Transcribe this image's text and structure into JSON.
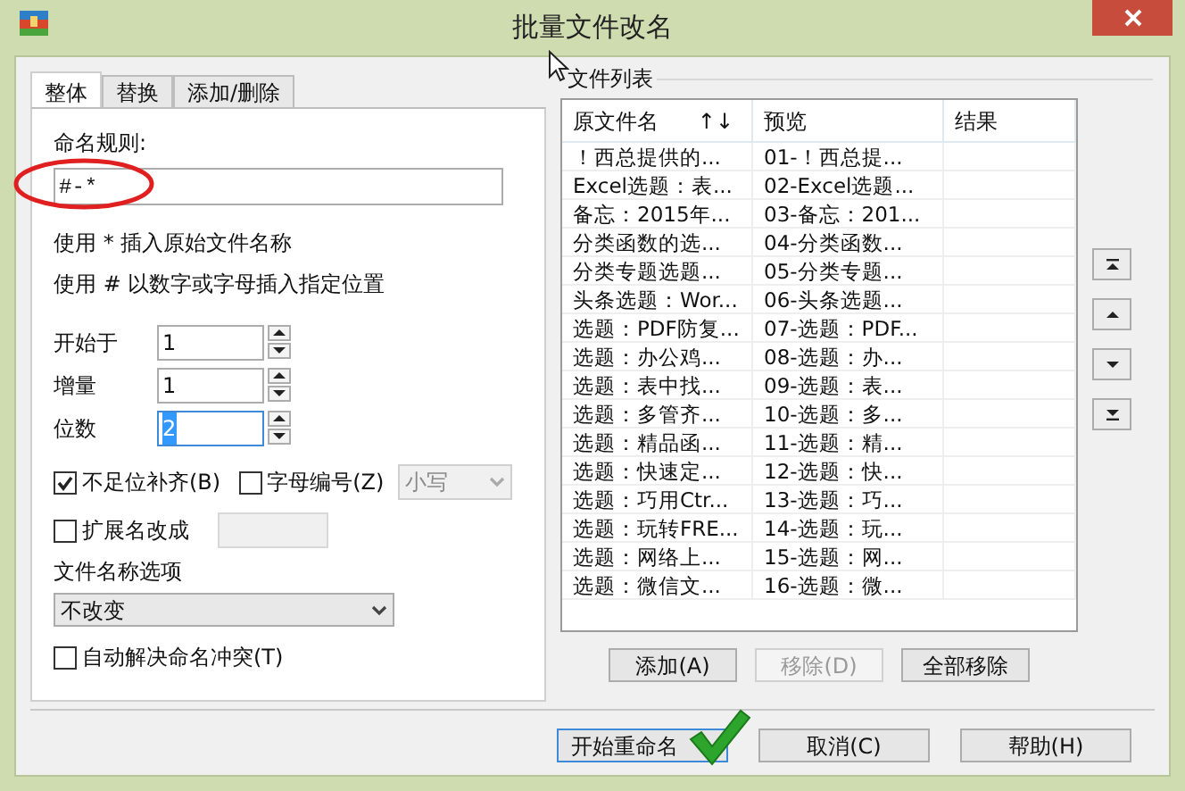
{
  "window": {
    "title": "批量文件改名"
  },
  "tabs": [
    {
      "label": "整体",
      "selected": true
    },
    {
      "label": "替换",
      "selected": false
    },
    {
      "label": "添加/删除",
      "selected": false
    }
  ],
  "rule": {
    "label": "命名规则:",
    "value": "#-*",
    "highlighted": true
  },
  "hints": [
    "使用 * 插入原始文件名称",
    "使用 # 以数字或字母插入指定位置"
  ],
  "spinners": [
    {
      "label": "开始于",
      "value": "1",
      "focused": false
    },
    {
      "label": "增量",
      "value": "1",
      "focused": false
    },
    {
      "label": "位数",
      "value": "2",
      "focused": true
    }
  ],
  "pad": {
    "label": "不足位补齐(B)",
    "checked": true
  },
  "letters": {
    "label": "字母编号(Z)",
    "checked": false
  },
  "case_select": {
    "value": "小写",
    "disabled": true
  },
  "ext": {
    "label": "扩展名改成",
    "checked": false,
    "disabled": true
  },
  "name_options": {
    "label": "文件名称选项",
    "value": "不改变"
  },
  "auto_resolve": {
    "label": "自动解决命名冲突(T)",
    "checked": false
  },
  "file_list": {
    "title": "文件列表",
    "columns": [
      "原文件名",
      "预览",
      "结果"
    ],
    "sort_arrows": "↑↓",
    "rows": [
      [
        "！西总提供的...",
        "01-！西总提..."
      ],
      [
        "Excel选题：表...",
        "02-Excel选题..."
      ],
      [
        "备忘：2015年...",
        "03-备忘：201..."
      ],
      [
        "分类函数的选...",
        "04-分类函数..."
      ],
      [
        "分类专题选题...",
        "05-分类专题..."
      ],
      [
        "头条选题：Wor...",
        "06-头条选题..."
      ],
      [
        "选题：PDF防复...",
        "07-选题：PDF..."
      ],
      [
        "选题：办公鸡...",
        "08-选题：办..."
      ],
      [
        "选题：表中找...",
        "09-选题：表..."
      ],
      [
        "选题：多管齐...",
        "10-选题：多..."
      ],
      [
        "选题：精品函...",
        "11-选题：精..."
      ],
      [
        "选题：快速定...",
        "12-选题：快..."
      ],
      [
        "选题：巧用Ctr...",
        "13-选题：巧..."
      ],
      [
        "选题：玩转FRE...",
        "14-选题：玩..."
      ],
      [
        "选题：网络上...",
        "15-选题：网..."
      ],
      [
        "选题：微信文...",
        "16-选题：微..."
      ]
    ]
  },
  "move_buttons": [
    {
      "kind": "top"
    },
    {
      "kind": "up"
    },
    {
      "kind": "down"
    },
    {
      "kind": "bottom"
    }
  ],
  "list_buttons": [
    {
      "label": "添加(A)",
      "disabled": false
    },
    {
      "label": "移除(D)",
      "disabled": true
    },
    {
      "label": "全部移除",
      "disabled": false
    }
  ],
  "footer_buttons": [
    {
      "label": "开始重命名",
      "default": true,
      "marked": true
    },
    {
      "label": "取消(C)",
      "default": false,
      "marked": false
    },
    {
      "label": "帮助(H)",
      "default": false,
      "marked": false
    }
  ]
}
